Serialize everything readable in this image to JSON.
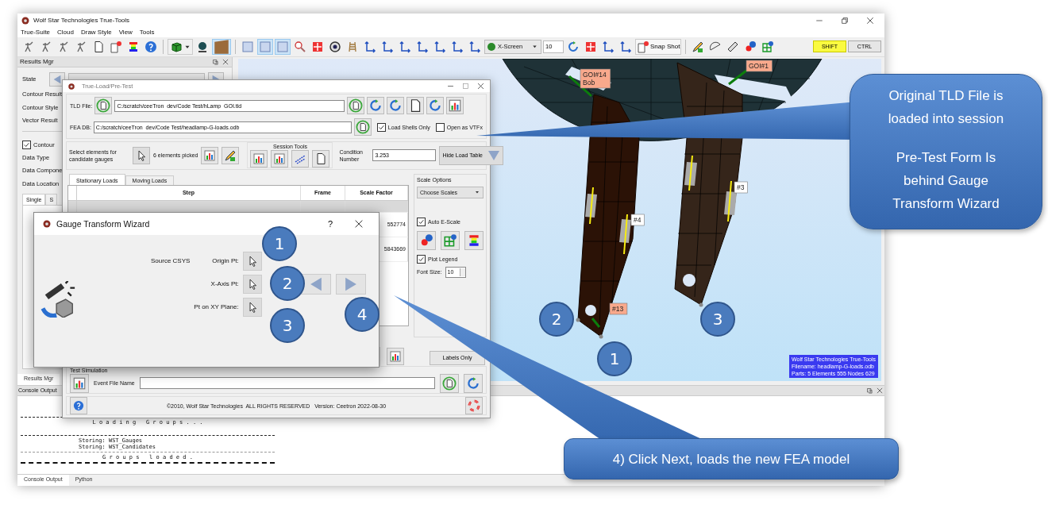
{
  "window": {
    "title": "Wolf Star Technologies True-Tools"
  },
  "menu": [
    "True-Suite",
    "Cloud",
    "Draw Style",
    "View",
    "Tools"
  ],
  "toolbar": {
    "view_dropdown": "X-Screen",
    "step_value": "10",
    "snapshot_button": "Snap Shot",
    "modifier_keys": [
      {
        "label": "SHIFT",
        "on": true
      },
      {
        "label": "CTRL",
        "on": false
      }
    ]
  },
  "results_manager": {
    "title": "Results Mgr",
    "fields": [
      "State",
      "Contour Result",
      "Contour Style",
      "Vector Result"
    ],
    "contour": {
      "label": "Contour",
      "checked": true
    },
    "data_fields": [
      "Data Type",
      "Data Compone",
      "Data Location"
    ],
    "tabs": [
      {
        "label": "Single",
        "selected": true
      },
      {
        "label": "S",
        "selected": false
      }
    ],
    "bottom_tab": "Results Mgr"
  },
  "viewport": {
    "gauge_labels": [
      {
        "lines": [
          "GOI#14",
          "Bob"
        ],
        "color": "#f9a98c"
      },
      {
        "lines": [
          "GOI#1"
        ],
        "color": "#f9a98c"
      },
      {
        "lines": [
          "#4"
        ],
        "color": "#ffffff"
      },
      {
        "lines": [
          "#3"
        ],
        "color": "#ffffff"
      },
      {
        "lines": [
          "#13"
        ],
        "color": "#f9a98c"
      }
    ],
    "markers": [
      "2",
      "1",
      "3"
    ],
    "info": [
      "Wolf Star Technologies True-Tools",
      "Filename: headlamp-G-loads.odb",
      "Parts: 5 Elements 555 Nodes 629"
    ]
  },
  "console": {
    "title": "Console Output",
    "lines": [
      {
        "kind": "heading",
        "text": "L o a d i n g   G r o u p s . . ."
      },
      {
        "kind": "entry",
        "text": "Storing: WST_Gauges"
      },
      {
        "kind": "entry",
        "text": "Storing: WST_Candidates"
      },
      {
        "kind": "heading",
        "text": "G r o u p s   l o a d e d ."
      }
    ],
    "tabs": [
      {
        "label": "Console Output",
        "selected": true
      },
      {
        "label": "Python",
        "selected": false
      }
    ]
  },
  "true_load_dialog": {
    "title": "True-Load/Pre-Test",
    "tld_label": "TLD File:",
    "tld_path": "C:/scratch/ceeTron_dev/Code Test/hLamp_GOI.tld",
    "fea_label": "FEA DB:",
    "fea_path": "C:/scratch/ceeTron_dev/Code Test/headlamp-G-loads.odb",
    "options": [
      {
        "label": "Load Shells Only",
        "checked": true
      },
      {
        "label": "Open as VTFx",
        "checked": false
      }
    ],
    "select_label": "Select elements for candidate gauges",
    "picked": "6 elements picked",
    "session_tools": "Session Tools",
    "condition_label": "Condition Number",
    "condition_value": "3.253",
    "hide_button": "Hide Load Table",
    "tabs": [
      {
        "label": "Stationary Loads",
        "selected": true
      },
      {
        "label": "Moving Loads",
        "selected": false
      }
    ],
    "columns": [
      "Step",
      "Frame",
      "Scale Factor"
    ],
    "scale_values": [
      "552774",
      "5843669"
    ],
    "scale_options": {
      "title": "Scale Options",
      "dropdown": "Choose Scales",
      "auto": {
        "label": "Auto E-Scale",
        "checked": true
      },
      "legend": {
        "label": "Plot Legend",
        "checked": true
      },
      "font_size_label": "Font Size:",
      "font_size": "10"
    },
    "labels_button": "Labels Only",
    "test_simulation": "Test Simulation",
    "event_label": "Event File Name",
    "copyright": "©2010, Wolf Star Technologies  ALL RIGHTS RESERVED   Version: Ceetron 2022-08-30"
  },
  "wizard": {
    "title": "Gauge Transform Wizard",
    "help": "?",
    "group_label": "Source CSYS",
    "points": [
      "Origin Pt:",
      "X-Axis Pt:",
      "Pt on XY Plane:"
    ],
    "markers": [
      "1",
      "2",
      "3",
      "4"
    ]
  },
  "callouts": [
    {
      "kind": "side",
      "paragraphs": [
        "Original TLD File is loaded into session",
        "Pre-Test Form Is behind Gauge Transform Wizard"
      ]
    },
    {
      "kind": "bottom",
      "paragraphs": [
        "4) Click Next, loads the new FEA model"
      ]
    }
  ]
}
